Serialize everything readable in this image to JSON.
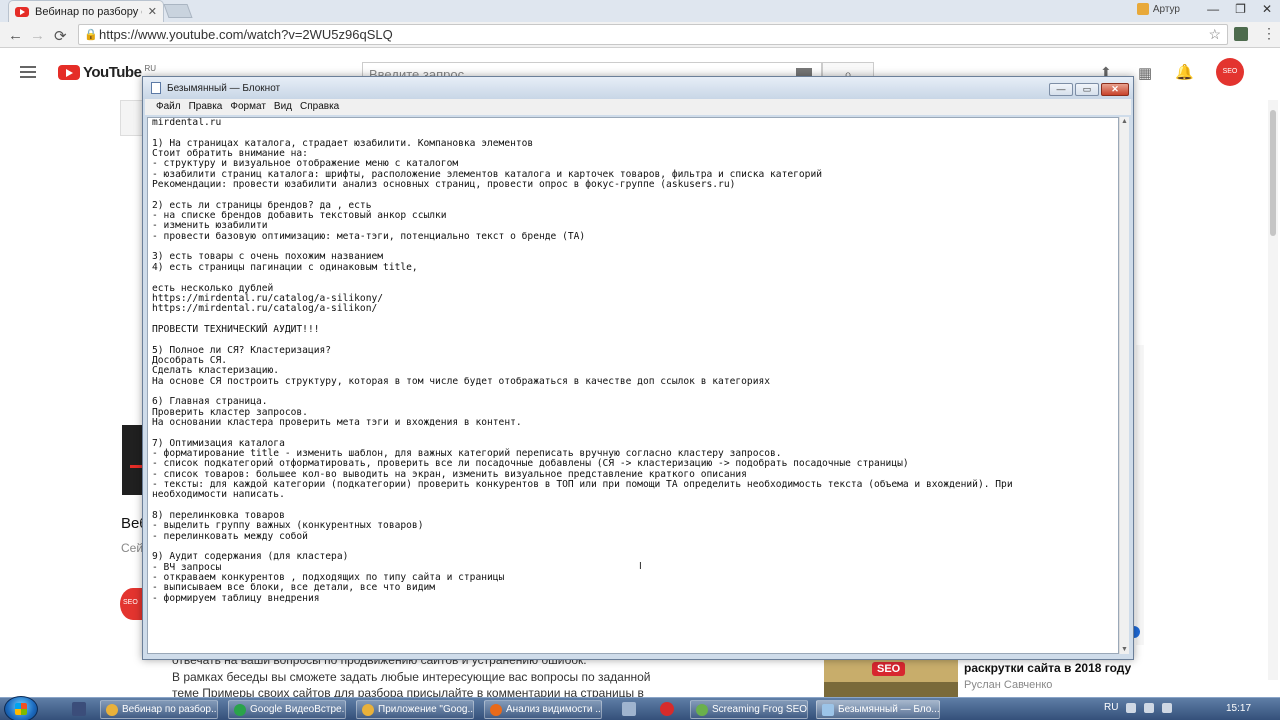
{
  "browser": {
    "tab_title": "Вебинар по разбору сай",
    "tab_close": "✕",
    "user_name": "Артур",
    "win_min": "—",
    "win_max": "❐",
    "win_close": "✕",
    "url": "https://www.youtube.com/watch?v=2WU5z96qSLQ",
    "back": "←",
    "forward": "→",
    "reload": "⟳",
    "star": "☆",
    "menu": "⋮"
  },
  "youtube": {
    "logo_word": "YouTube",
    "logo_region": "RU",
    "search_placeholder": "Введите запрос",
    "search_icon": "⌕",
    "upload_icon": "⬆",
    "apps_icon": "▦",
    "bell_icon": "🔔",
    "avatar_text": "SEO",
    "video_title_fragment": "Веб",
    "views_fragment": "Сей",
    "channel_icon_text": "SEO",
    "description_lines": [
      "отвечать на ваши вопросы по продвижению сайтов и устранению ошибок.",
      "В рамках беседы вы сможете задать любые интересующие вас вопросы по заданной",
      "теме Примеры своих сайтов для разбора присылайте в комментарии на страницы в"
    ],
    "recommended": {
      "thumb_badge": "SEO",
      "title": "раскрутки сайта в 2018 году",
      "author": "Руслан Савченко"
    }
  },
  "notepad": {
    "title": "Безымянный — Блокнот",
    "menu": [
      "Файл",
      "Правка",
      "Формат",
      "Вид",
      "Справка"
    ],
    "btn_min": "—",
    "btn_max": "▭",
    "btn_close": "✕",
    "cursor": "I",
    "scroll_up": "▲",
    "scroll_down": "▼",
    "content": "mirdental.ru\n\n1) На страницах каталога, страдает юзабилити. Компановка элементов\nСтоит обратить внимание на:\n- структуру и визуальное отображение меню с каталогом\n- юзабилити страниц каталога: шрифты, расположение элементов каталога и карточек товаров, фильтра и списка категорий\nРекомендации: провести юзабилити анализ основных страниц, провести опрос в фокус-группе (askusers.ru)\n\n2) есть ли страницы брендов? да , есть\n- на списке брендов добавить текстовый анкор ссылки\n- изменить юзабилити\n- провести базовую оптимизацию: мета-тэги, потенциально текст о бренде (ТА)\n\n3) есть товары с очень похожим названием\n4) есть страницы пагинации с одинаковым title,\n\nесть несколько дублей\nhttps://mirdental.ru/catalog/a-silikony/\nhttps://mirdental.ru/catalog/a-silikon/\n\nПРОВЕСТИ ТЕХНИЧЕСКИЙ АУДИТ!!!\n\n5) Полное ли СЯ? Кластеризация?\nДособрать СЯ.\nСделать кластеризацию.\nНа основе СЯ построить структуру, которая в том числе будет отображаться в качестве доп ссылок в категориях\n\n6) Главная страница.\nПроверить кластер запросов.\nНа основании кластера проверить мета тэги и вхождения в контент.\n\n7) Оптимизация каталога\n- форматирование title - изменить шаблон, для важных категорий переписать вручную согласно кластеру запросов.\n- список подкатегорий отформатировать, проверить все ли посадочные добавлены (СЯ -> кластеризацию -> подобрать посадочные страницы)\n- список товаров: большее кол-во выводить на экран, изменить визуальное представление краткого описания\n- тексты: для каждой категории (подкатегории) проверить конкурентов в ТОП или при помощи ТА определить необходимость текста (объема и вхождений). При\nнеобходимости написать.\n\n8) перелинковка товаров\n- выделить группу важных (конкурентных товаров)\n- перелинковать между собой\n\n9) Аудит содержания (для кластера)\n- ВЧ запросы\n- откраваем конкурентов , подходящих по типу сайта и страницы\n- выписываем все блоки, все детали, все что видим\n- формируем таблицу внедрения"
  },
  "taskbar": {
    "items": [
      {
        "label": "Вебинар по разбор...",
        "icon_color": "#e9b13a"
      },
      {
        "label": "Google ВидеоВстре...",
        "icon_color": "#2aa34a"
      },
      {
        "label": "Приложение \"Goog...",
        "icon_color": "#e9b13a"
      },
      {
        "label": "Анализ видимости ...",
        "icon_color": "#e86a1a"
      },
      {
        "label": "Screaming Frog SEO ...",
        "icon_color": "#6ab04c"
      },
      {
        "label": "Безымянный — Бло...",
        "icon_color": "#9cc4e8"
      }
    ],
    "lang": "RU",
    "clock": "15:17"
  }
}
